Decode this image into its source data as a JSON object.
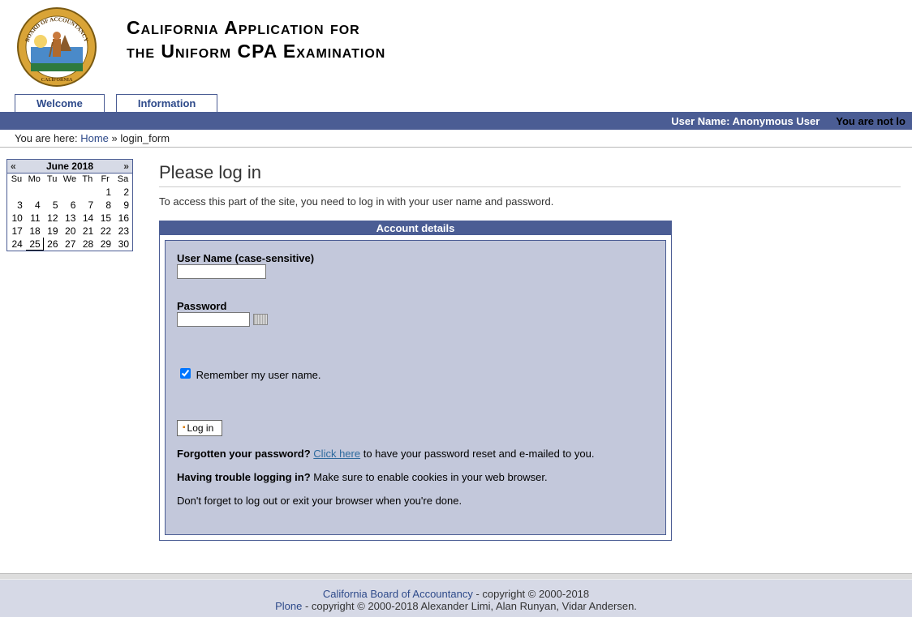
{
  "header": {
    "title_line1": "California Application for",
    "title_line2": "the Uniform CPA Examination"
  },
  "tabs": {
    "welcome": "Welcome",
    "information": "Information"
  },
  "userbar": {
    "label": "User Name:",
    "user": "Anonymous User",
    "status": "You are not lo"
  },
  "breadcrumb": {
    "prefix": "You are here:",
    "home": "Home",
    "sep": "»",
    "current": "login_form"
  },
  "calendar": {
    "prev": "«",
    "next": "»",
    "title": "June 2018",
    "dow": [
      "Su",
      "Mo",
      "Tu",
      "We",
      "Th",
      "Fr",
      "Sa"
    ],
    "weeks": [
      [
        "",
        "",
        "",
        "",
        "",
        "1",
        "2"
      ],
      [
        "3",
        "4",
        "5",
        "6",
        "7",
        "8",
        "9"
      ],
      [
        "10",
        "11",
        "12",
        "13",
        "14",
        "15",
        "16"
      ],
      [
        "17",
        "18",
        "19",
        "20",
        "21",
        "22",
        "23"
      ],
      [
        "24",
        "25",
        "26",
        "27",
        "28",
        "29",
        "30"
      ]
    ],
    "today": "25"
  },
  "page": {
    "title": "Please log in",
    "intro": "To access this part of the site, you need to log in with your user name and password.",
    "account_heading": "Account details",
    "username_label": "User Name (case-sensitive)",
    "username_value": "",
    "password_label": "Password",
    "password_value": "",
    "remember_label": "Remember my user name.",
    "remember_checked": true,
    "login_button": "Log in",
    "forgot_strong": "Forgotten your password?",
    "forgot_link": "Click here",
    "forgot_rest": " to have your password reset and e-mailed to you.",
    "trouble_strong": "Having trouble logging in?",
    "trouble_rest": " Make sure to enable cookies in your web browser.",
    "logout_reminder": "Don't forget to log out or exit your browser when you're done."
  },
  "footer": {
    "link1": "California Board of Accountancy",
    "line1_rest": " - copyright © 2000-2018",
    "link2": "Plone",
    "line2_rest": " - copyright © 2000-2018 Alexander Limi, Alan Runyan, Vidar Andersen."
  }
}
